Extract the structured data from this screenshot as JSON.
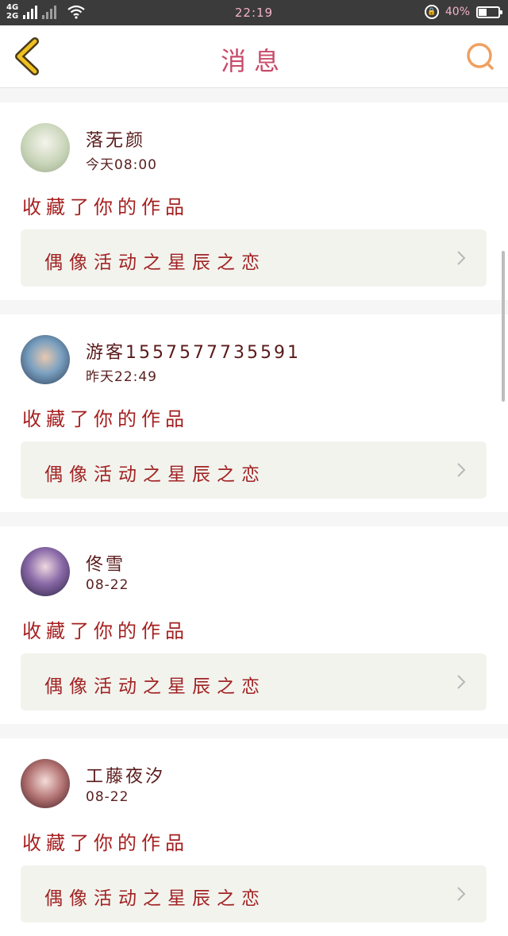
{
  "status_bar": {
    "network_top": "4G",
    "network_bottom": "2G",
    "time": "22:19",
    "battery_percent_label": "40%",
    "battery_level": 0.4
  },
  "header": {
    "title": "消息",
    "back_icon": "chevron-left-icon",
    "search_icon": "search-icon",
    "accent_color": "#f0c020"
  },
  "messages": [
    {
      "username": "落无颜",
      "time": "今天08:00",
      "action": "收藏了你的作品",
      "work_title": "偶像活动之星辰之恋"
    },
    {
      "username": "游客1557577735591",
      "time": "昨天22:49",
      "action": "收藏了你的作品",
      "work_title": "偶像活动之星辰之恋"
    },
    {
      "username": "佟雪",
      "time": "08-22",
      "action": "收藏了你的作品",
      "work_title": "偶像活动之星辰之恋"
    },
    {
      "username": "工藤夜汐",
      "time": "08-22",
      "action": "收藏了你的作品",
      "work_title": "偶像活动之星辰之恋"
    }
  ]
}
